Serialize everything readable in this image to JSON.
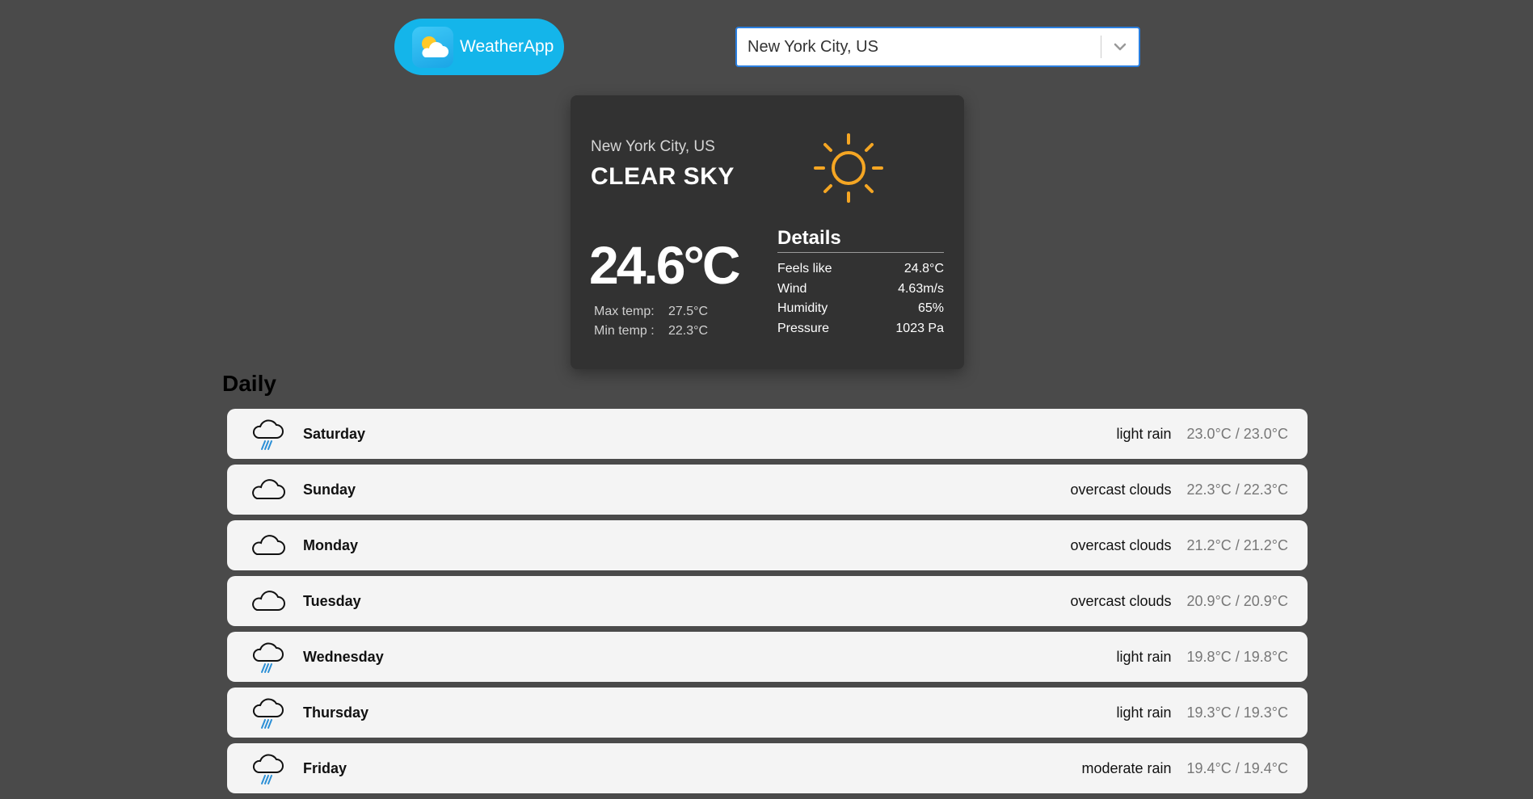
{
  "header": {
    "app_name": "WeatherApp",
    "logo_icon": "sun-behind-cloud-icon",
    "city_select": {
      "value": "New York City, US",
      "icon": "chevron-down-icon"
    }
  },
  "current": {
    "city": "New York City, US",
    "description": "CLEAR SKY",
    "icon": "sun-icon",
    "temperature": "24.6°C",
    "max_label": "Max temp:",
    "max_value": "27.5°C",
    "min_label": "Min temp :",
    "min_value": "22.3°C",
    "details": {
      "title": "Details",
      "rows": [
        {
          "label": "Feels like",
          "value": "24.8°C"
        },
        {
          "label": "Wind",
          "value": "4.63m/s"
        },
        {
          "label": "Humidity",
          "value": "65%"
        },
        {
          "label": "Pressure",
          "value": "1023 Pa"
        }
      ]
    }
  },
  "daily": {
    "title": "Daily",
    "items": [
      {
        "day": "Saturday",
        "condition": "light rain",
        "range": "23.0°C / 23.0°C",
        "icon": "rain-cloud-icon"
      },
      {
        "day": "Sunday",
        "condition": "overcast clouds",
        "range": "22.3°C / 22.3°C",
        "icon": "cloud-icon"
      },
      {
        "day": "Monday",
        "condition": "overcast clouds",
        "range": "21.2°C / 21.2°C",
        "icon": "cloud-icon"
      },
      {
        "day": "Tuesday",
        "condition": "overcast clouds",
        "range": "20.9°C / 20.9°C",
        "icon": "cloud-icon"
      },
      {
        "day": "Wednesday",
        "condition": "light rain",
        "range": "19.8°C / 19.8°C",
        "icon": "rain-cloud-icon"
      },
      {
        "day": "Thursday",
        "condition": "light rain",
        "range": "19.3°C / 19.3°C",
        "icon": "rain-cloud-icon"
      },
      {
        "day": "Friday",
        "condition": "moderate rain",
        "range": "19.4°C / 19.4°C",
        "icon": "rain-cloud-icon"
      }
    ]
  },
  "colors": {
    "background": "#4a4a4a",
    "brand": "#14b5ea",
    "card": "#323232",
    "sun": "#f5a623",
    "rain": "#2b8fd6"
  }
}
